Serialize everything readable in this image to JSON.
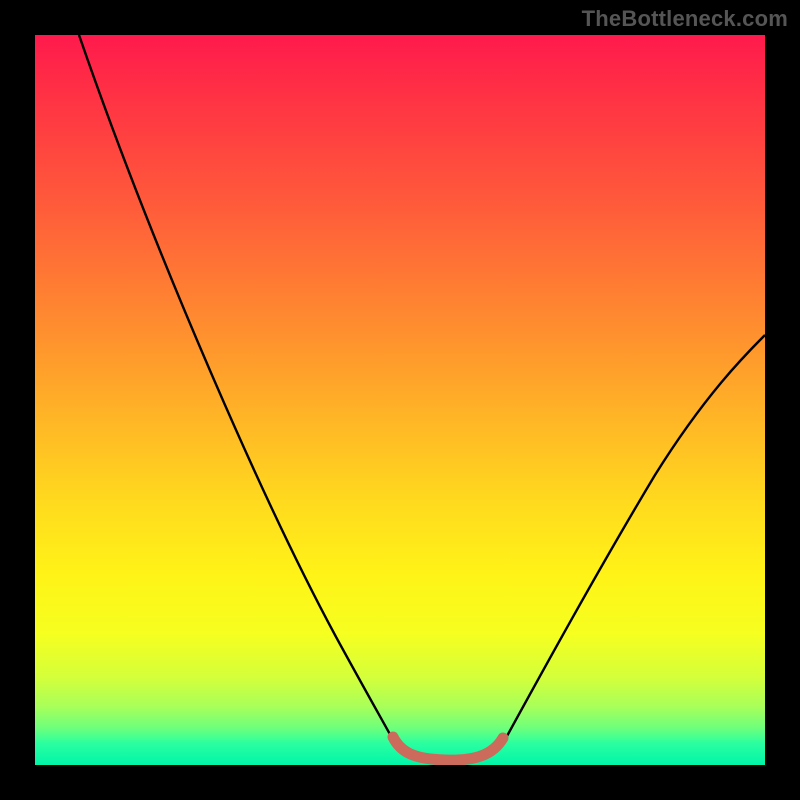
{
  "watermark": "TheBottleneck.com",
  "chart_data": {
    "type": "line",
    "title": "",
    "xlabel": "",
    "ylabel": "",
    "xlim": [
      0,
      100
    ],
    "ylim": [
      0,
      100
    ],
    "background_gradient": {
      "stops": [
        {
          "pos": 0,
          "color": "#ff1a4d"
        },
        {
          "pos": 50,
          "color": "#ffda1e"
        },
        {
          "pos": 85,
          "color": "#f6ff20"
        },
        {
          "pos": 100,
          "color": "#00f5a8"
        }
      ]
    },
    "series": [
      {
        "name": "curve-left",
        "color": "#000000",
        "points": [
          {
            "x": 6,
            "y": 100
          },
          {
            "x": 20,
            "y": 65
          },
          {
            "x": 35,
            "y": 30
          },
          {
            "x": 45,
            "y": 10
          },
          {
            "x": 49,
            "y": 3
          }
        ]
      },
      {
        "name": "curve-right",
        "color": "#000000",
        "points": [
          {
            "x": 64,
            "y": 3
          },
          {
            "x": 72,
            "y": 18
          },
          {
            "x": 85,
            "y": 40
          },
          {
            "x": 95,
            "y": 55
          },
          {
            "x": 100,
            "y": 60
          }
        ]
      },
      {
        "name": "trough-band",
        "color": "#cc6b5c",
        "points": [
          {
            "x": 49,
            "y": 4
          },
          {
            "x": 51,
            "y": 1.5
          },
          {
            "x": 56,
            "y": 1.0
          },
          {
            "x": 61,
            "y": 1.5
          },
          {
            "x": 63,
            "y": 4
          }
        ]
      }
    ]
  }
}
